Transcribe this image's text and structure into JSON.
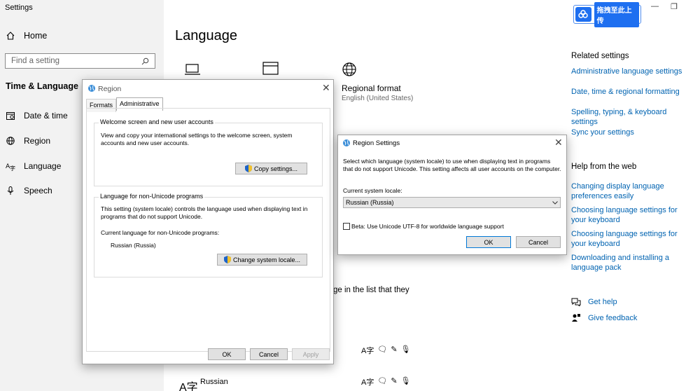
{
  "app": {
    "title": "Settings"
  },
  "sidebar": {
    "home_label": "Home",
    "search_placeholder": "Find a setting",
    "section_title": "Time & Language",
    "items": [
      {
        "label": "Date & time",
        "icon": "calendar-icon"
      },
      {
        "label": "Region",
        "icon": "globe-icon"
      },
      {
        "label": "Language",
        "icon": "language-icon"
      },
      {
        "label": "Speech",
        "icon": "microphone-icon"
      }
    ]
  },
  "main": {
    "page_title": "Language",
    "regional_format": {
      "title": "Regional format",
      "subtitle": "English (United States)"
    },
    "fragment_text": "ge in the list that they",
    "language_name": "Russian"
  },
  "right_panel": {
    "related_heading": "Related settings",
    "related_links": [
      "Administrative language settings",
      "Date, time & regional formatting",
      "Spelling, typing, & keyboard settings",
      "Sync your settings"
    ],
    "web_heading": "Help from the web",
    "web_links": [
      "Changing display language preferences easily",
      "Choosing language settings for your keyboard",
      "Choosing language settings for your keyboard",
      "Downloading and installing a language pack"
    ],
    "get_help": "Get help",
    "give_feedback": "Give feedback"
  },
  "baidu": {
    "label": "拖拽至此上传"
  },
  "region_dialog": {
    "title": "Region",
    "tabs": [
      "Formats",
      "Administrative"
    ],
    "welcome_group": {
      "legend": "Welcome screen and new user accounts",
      "text": "View and copy your international settings to the welcome screen, system accounts and new user accounts.",
      "button": "Copy settings..."
    },
    "nonunicode_group": {
      "legend": "Language for non-Unicode programs",
      "text": "This setting (system locale) controls the language used when displaying text in programs that do not support Unicode.",
      "current_label": "Current language for non-Unicode programs:",
      "current_value": "Russian (Russia)",
      "button": "Change system locale..."
    },
    "ok": "OK",
    "cancel": "Cancel",
    "apply": "Apply"
  },
  "region_settings_dialog": {
    "title": "Region Settings",
    "description": "Select which language (system locale) to use when displaying text in programs that do not support Unicode. This setting affects all user accounts on the computer.",
    "locale_label": "Current system locale:",
    "locale_value": "Russian (Russia)",
    "beta_label": "Beta: Use Unicode UTF-8 for worldwide language support",
    "ok": "OK",
    "cancel": "Cancel"
  },
  "colors": {
    "link": "#0063b1",
    "accent": "#0078d7",
    "sidebar_bg": "#f2f2f2"
  }
}
